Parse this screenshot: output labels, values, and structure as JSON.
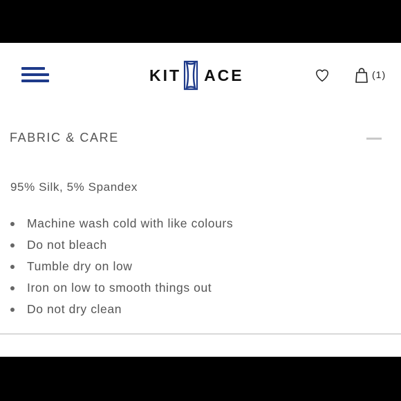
{
  "header": {
    "logo_left": "KIT",
    "logo_right": "ACE",
    "cart_count": "(1)",
    "icons": {
      "menu": "hamburger-menu-icon",
      "wishlist": "heart-icon",
      "cart": "shopping-bag-icon"
    },
    "colors": {
      "menu": "#1e3a8a",
      "logo_mark": "#1e3a8a"
    }
  },
  "fabric_care": {
    "title": "FABRIC & CARE",
    "composition": "95% Silk, 5% Spandex",
    "instructions": [
      "Machine wash cold with like colours",
      "Do not bleach",
      "Tumble dry on low",
      "Iron on low to smooth things out",
      "Do not dry clean"
    ]
  }
}
